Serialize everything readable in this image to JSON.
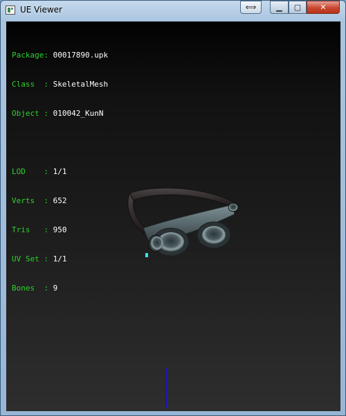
{
  "window": {
    "title": "UE Viewer"
  },
  "titlebar_buttons": {
    "swap_symbol": "⟺",
    "min_symbol": "▁",
    "max_symbol": "▢",
    "close_symbol": "✕"
  },
  "info": {
    "rows1": [
      {
        "key": "Package: ",
        "value": "00017890.upk"
      },
      {
        "key": "Class  : ",
        "value": "SkeletalMesh"
      },
      {
        "key": "Object : ",
        "value": "010042_KunN"
      }
    ],
    "rows2": [
      {
        "key": "LOD    : ",
        "value": "1/1"
      },
      {
        "key": "Verts  : ",
        "value": "652"
      },
      {
        "key": "Tris   : ",
        "value": "950"
      },
      {
        "key": "UV Set : ",
        "value": "1/1"
      },
      {
        "key": "Bones  : ",
        "value": "9"
      }
    ]
  },
  "colors": {
    "label": "#2fd02f",
    "value": "#ffffff",
    "axis": "#1414c8"
  }
}
